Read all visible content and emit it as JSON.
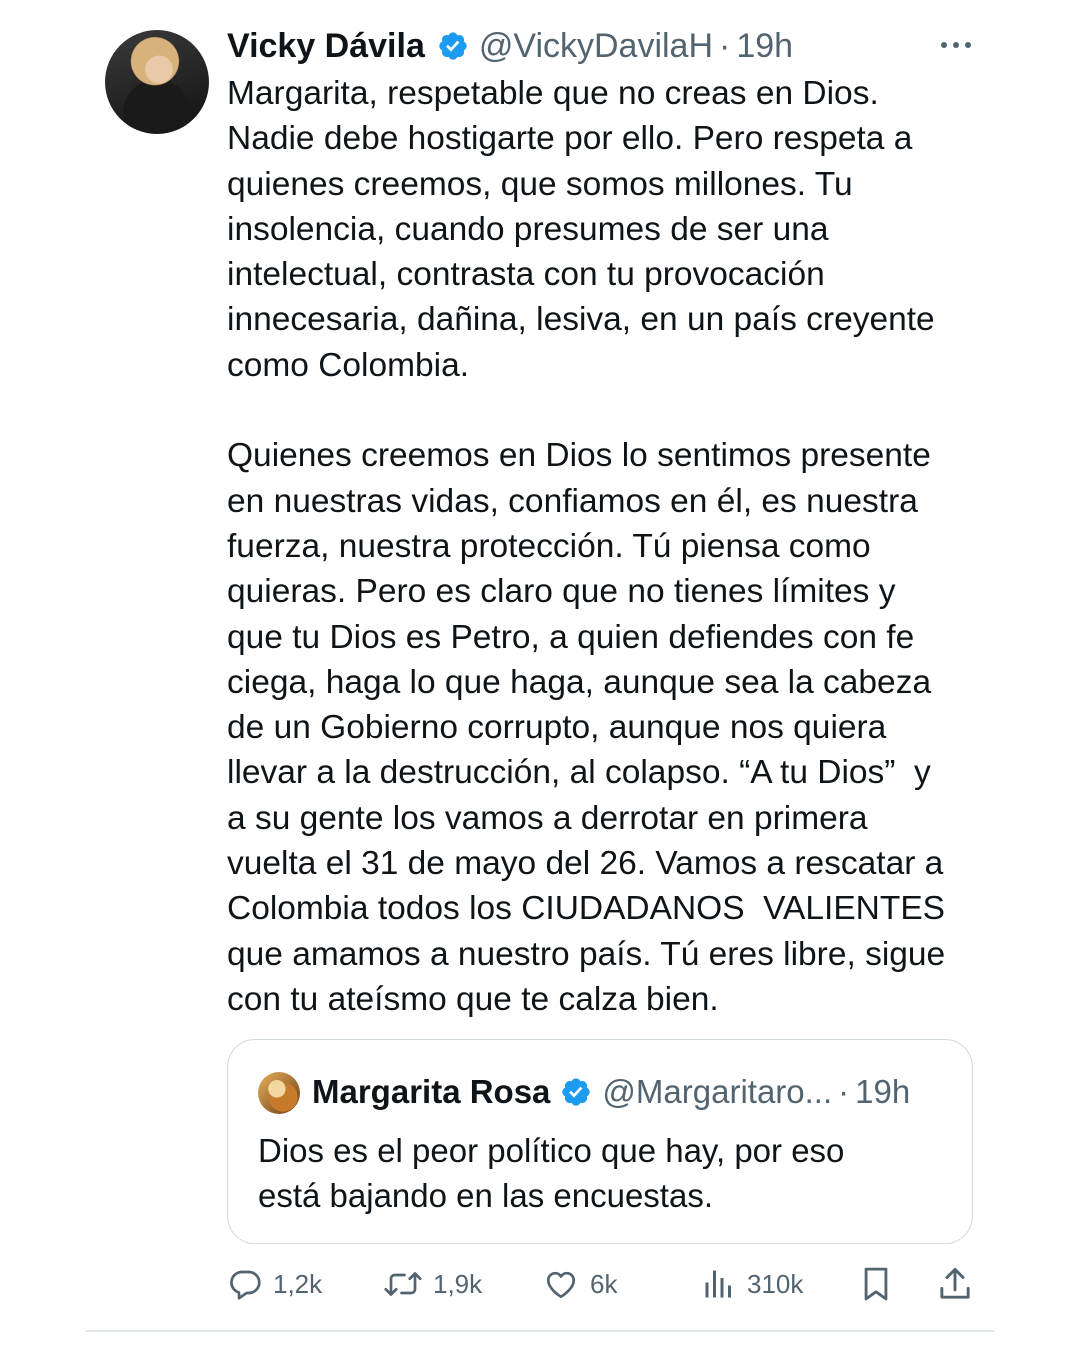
{
  "tweet": {
    "author_name": "Vicky Dávila",
    "author_handle": "@VickyDavilaH",
    "separator": "·",
    "time": "19h",
    "text": "Margarita, respetable que no creas en Dios.\nNadie debe hostigarte por ello. Pero respeta a\nquienes creemos, que somos millones. Tu\ninsolencia, cuando presumes de ser una\nintelectual, contrasta con tu provocación\ninnecesaria, dañina, lesiva, en un país creyente\ncomo Colombia.\n\nQuienes creemos en Dios lo sentimos presente\nen nuestras vidas, confiamos en él, es nuestra\nfuerza, nuestra protección. Tú piensa como\nquieras. Pero es claro que no tienes límites y\nque tu Dios es Petro, a quien defiendes con fe\nciega, haga lo que haga, aunque sea la cabeza\nde un Gobierno corrupto, aunque nos quiera\nllevar a la destrucción, al colapso. “A tu Dios”  y\na su gente los vamos a derrotar en primera\nvuelta el 31 de mayo del 26. Vamos a rescatar a\nColombia todos los CIUDADANOS  VALIENTES\nque amamos a nuestro país. Tú eres libre, sigue\ncon tu ateísmo que te calza bien."
  },
  "quoted": {
    "author_name": "Margarita Rosa",
    "author_handle": "@Margaritaro...",
    "separator": "·",
    "time": "19h",
    "text": "Dios es el peor político que hay, por eso\nestá bajando en las encuestas."
  },
  "actions": {
    "replies": "1,2k",
    "retweets": "1,9k",
    "likes": "6k",
    "views": "310k"
  },
  "icons": {
    "verified": "verified-badge-icon",
    "more": "more-icon",
    "reply": "reply-icon",
    "retweet": "retweet-icon",
    "like": "heart-icon",
    "views": "views-icon",
    "bookmark": "bookmark-icon",
    "share": "share-icon"
  },
  "colors": {
    "verified": "#1d9bf0",
    "secondary_text": "#536471",
    "primary_text": "#0f1419"
  }
}
